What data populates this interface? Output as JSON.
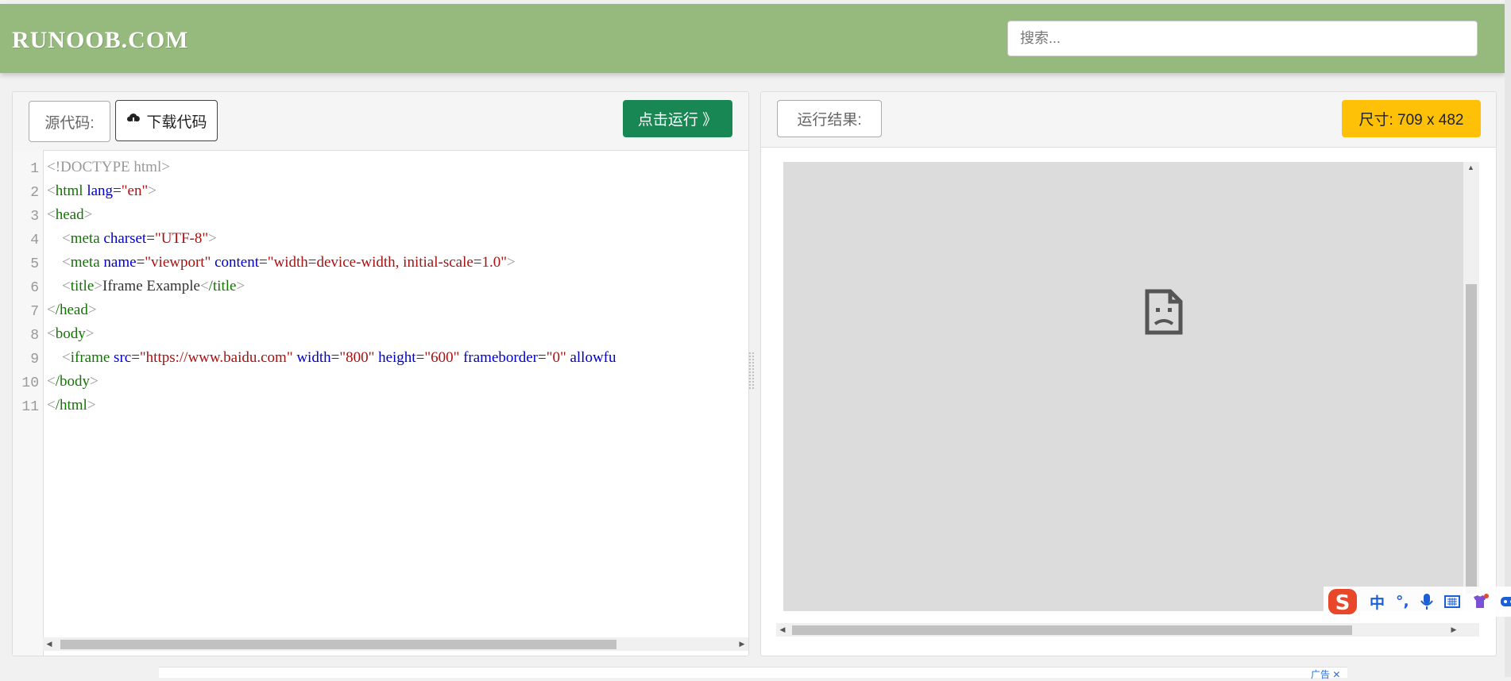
{
  "header": {
    "logo": "RUNOOB.COM",
    "search_placeholder": "搜索..."
  },
  "editor": {
    "source_label": "源代码:",
    "download_label": "下载代码",
    "run_label": "点击运行 》",
    "line_numbers": [
      "1",
      "2",
      "3",
      "4",
      "5",
      "6",
      "7",
      "8",
      "9",
      "10",
      "11"
    ],
    "code": {
      "l1": "<!DOCTYPE html>",
      "l2_tag": "html",
      "l2_attr": "lang",
      "l2_val": "\"en\"",
      "l3_tag": "head",
      "l4_tag": "meta",
      "l4_attr": "charset",
      "l4_val": "\"UTF-8\"",
      "l5_tag": "meta",
      "l5_attr1": "name",
      "l5_val1": "\"viewport\"",
      "l5_attr2": "content",
      "l5_val2": "\"width=device-width, initial-scale=1.0\"",
      "l6_tag": "title",
      "l6_text": "Iframe Example",
      "l6_close": "/title",
      "l7_tag": "/head",
      "l8_tag": "body",
      "l9_tag": "iframe",
      "l9_attr1": "src",
      "l9_val1": "\"https://www.baidu.com\"",
      "l9_attr2": "width",
      "l9_val2": "\"800\"",
      "l9_attr3": "height",
      "l9_val3": "\"600\"",
      "l9_attr4": "frameborder",
      "l9_val4": "\"0\"",
      "l9_attr5": "allowfu",
      "l10_tag": "/body",
      "l11_tag": "/html"
    }
  },
  "result": {
    "label": "运行结果:",
    "size_badge": "尺寸: 709 x 482"
  },
  "ime": {
    "mode": "中",
    "punct": "°,"
  },
  "ad_label": "广告"
}
